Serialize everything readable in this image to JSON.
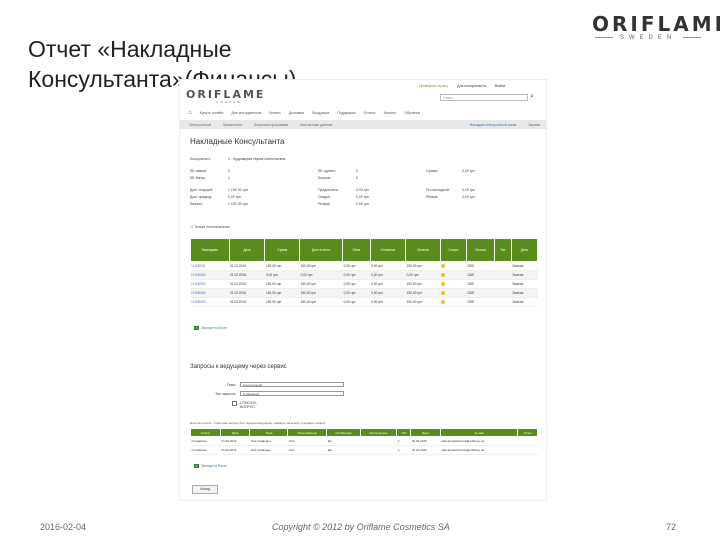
{
  "slide": {
    "title": "Отчет «Накладные Консультанта»(Финансы)",
    "brand_name": "ORIFLAME",
    "brand_sub": "SWEDEN",
    "date": "2016-02-04",
    "copyright": "Copyright © 2012 by Oriflame Cosmetics SA",
    "page": "72"
  },
  "app": {
    "logo": "ORIFLAME",
    "logo_sub": "SWEDEN",
    "top_links": [
      "Проверьте страну",
      "Для консультанта",
      "Выйти"
    ],
    "search_placeholder": "Поиск",
    "main_nav": [
      "Купить онлайн",
      "Для инструментов",
      "Бизнес",
      "Доставка",
      "Продукция",
      "Поддержка",
      "Отчеты",
      "Каталог",
      "Обучение"
    ],
    "sub_nav": [
      "Электронный",
      "Зачисления",
      "Бонусная программа",
      "Контактные данные"
    ],
    "sub_nav_right": [
      "Наладим электронный заказ",
      "Заказы"
    ],
    "page_title": "Накладные Консультанта"
  },
  "info": {
    "consultant_label": "Консультант:",
    "consultant_value": "1 - Кудрявцева Ирина Анатольевна",
    "rows": [
      [
        "ББ сумма:",
        "0",
        "ББ группы:",
        "0",
        "Сумма:",
        "0,00 грн"
      ],
      [
        "ББ бонус:",
        "1",
        "Бонусы:",
        "0",
        "",
        ""
      ],
      [
        "Долг текущий:",
        "1 152,00 грн",
        "Предоплата:",
        "0,00 грн",
        "По накладной:",
        "0,00 грн"
      ],
      [
        "Долг предыд:",
        "0,00 грн",
        "Скидка:",
        "0,00 грн",
        "Резерв:",
        "0,00 грн"
      ],
      [
        "Баланс:",
        "1 152,00 грн",
        "Резерв:",
        "0,00 грн",
        "",
        ""
      ]
    ],
    "checkbox_label": "Только неоплаченные"
  },
  "invoices": {
    "headers": [
      "Накладная",
      "Дата",
      "Сумма",
      "Долг в нетто",
      "Пени",
      "Оплачено",
      "Остаток",
      "Статус",
      "Оплата",
      "Тип",
      "Дата"
    ],
    "rows": [
      [
        "Н-000001",
        "01.02.2016",
        "150,00 грн",
        "150,00 грн",
        "0,00 грн",
        "0,00 грн",
        "150,00 грн",
        "",
        "",
        "DDE",
        "Эконом"
      ],
      [
        "Н-000002",
        "01.02.2016",
        "0,00 грн",
        "0,00 грн",
        "0,00 грн",
        "0,00 грн",
        "0,00 грн",
        "",
        "",
        "DDE",
        "Эконом"
      ],
      [
        "Н-000003",
        "01.02.2016",
        "150,00 грн",
        "150,00 грн",
        "0,00 грн",
        "0,00 грн",
        "150,00 грн",
        "",
        "",
        "DDE",
        "Эконом"
      ],
      [
        "Н-000004",
        "01.02.2016",
        "150,00 грн",
        "150,00 грн",
        "0,00 грн",
        "0,00 грн",
        "150,00 грн",
        "",
        "",
        "DDE",
        "Эконом"
      ],
      [
        "Н-000005",
        "01.02.2016",
        "150,00 грн",
        "150,00 грн",
        "0,00 грн",
        "0,00 грн",
        "150,00 грн",
        "",
        "",
        "DDE",
        "Эконом"
      ]
    ],
    "export_label": "Экспорт в Excel"
  },
  "requests": {
    "heading": "Запросы к ведущему через сервис",
    "fields": [
      {
        "label": "Тема:",
        "value": "Консультации"
      },
      {
        "label": "Тип запроса:",
        "value": "Сообщение"
      }
    ],
    "checkbox_label": "СПИСАТЬ ВОПРОС",
    "note": "Если вы хотите, чтобы ваш вопрос был передан ведущему, нажмите на кнопку отправить запрос.",
    "headers": [
      "Статус",
      "Дата",
      "Тема",
      "Пользователь",
      "Сообщение",
      "Исполнитель",
      "Тип",
      "Дата",
      "E-mail",
      "Ответ"
    ],
    "rows": [
      [
        "Отправлен",
        "01.02.2016",
        "Test Catalogue",
        "Test",
        "Да",
        "",
        "1",
        "01.02.2016",
        "olga.konstantinova@oriflame.ua",
        ""
      ],
      [
        "Отправлен",
        "01.02.2016",
        "Test Catalogue",
        "Test",
        "Да",
        "",
        "1",
        "01.02.2016",
        "olga.konstantinova@oriflame.ua",
        ""
      ]
    ],
    "export_label": "Экспорт в Excel",
    "back_label": "Назад"
  }
}
